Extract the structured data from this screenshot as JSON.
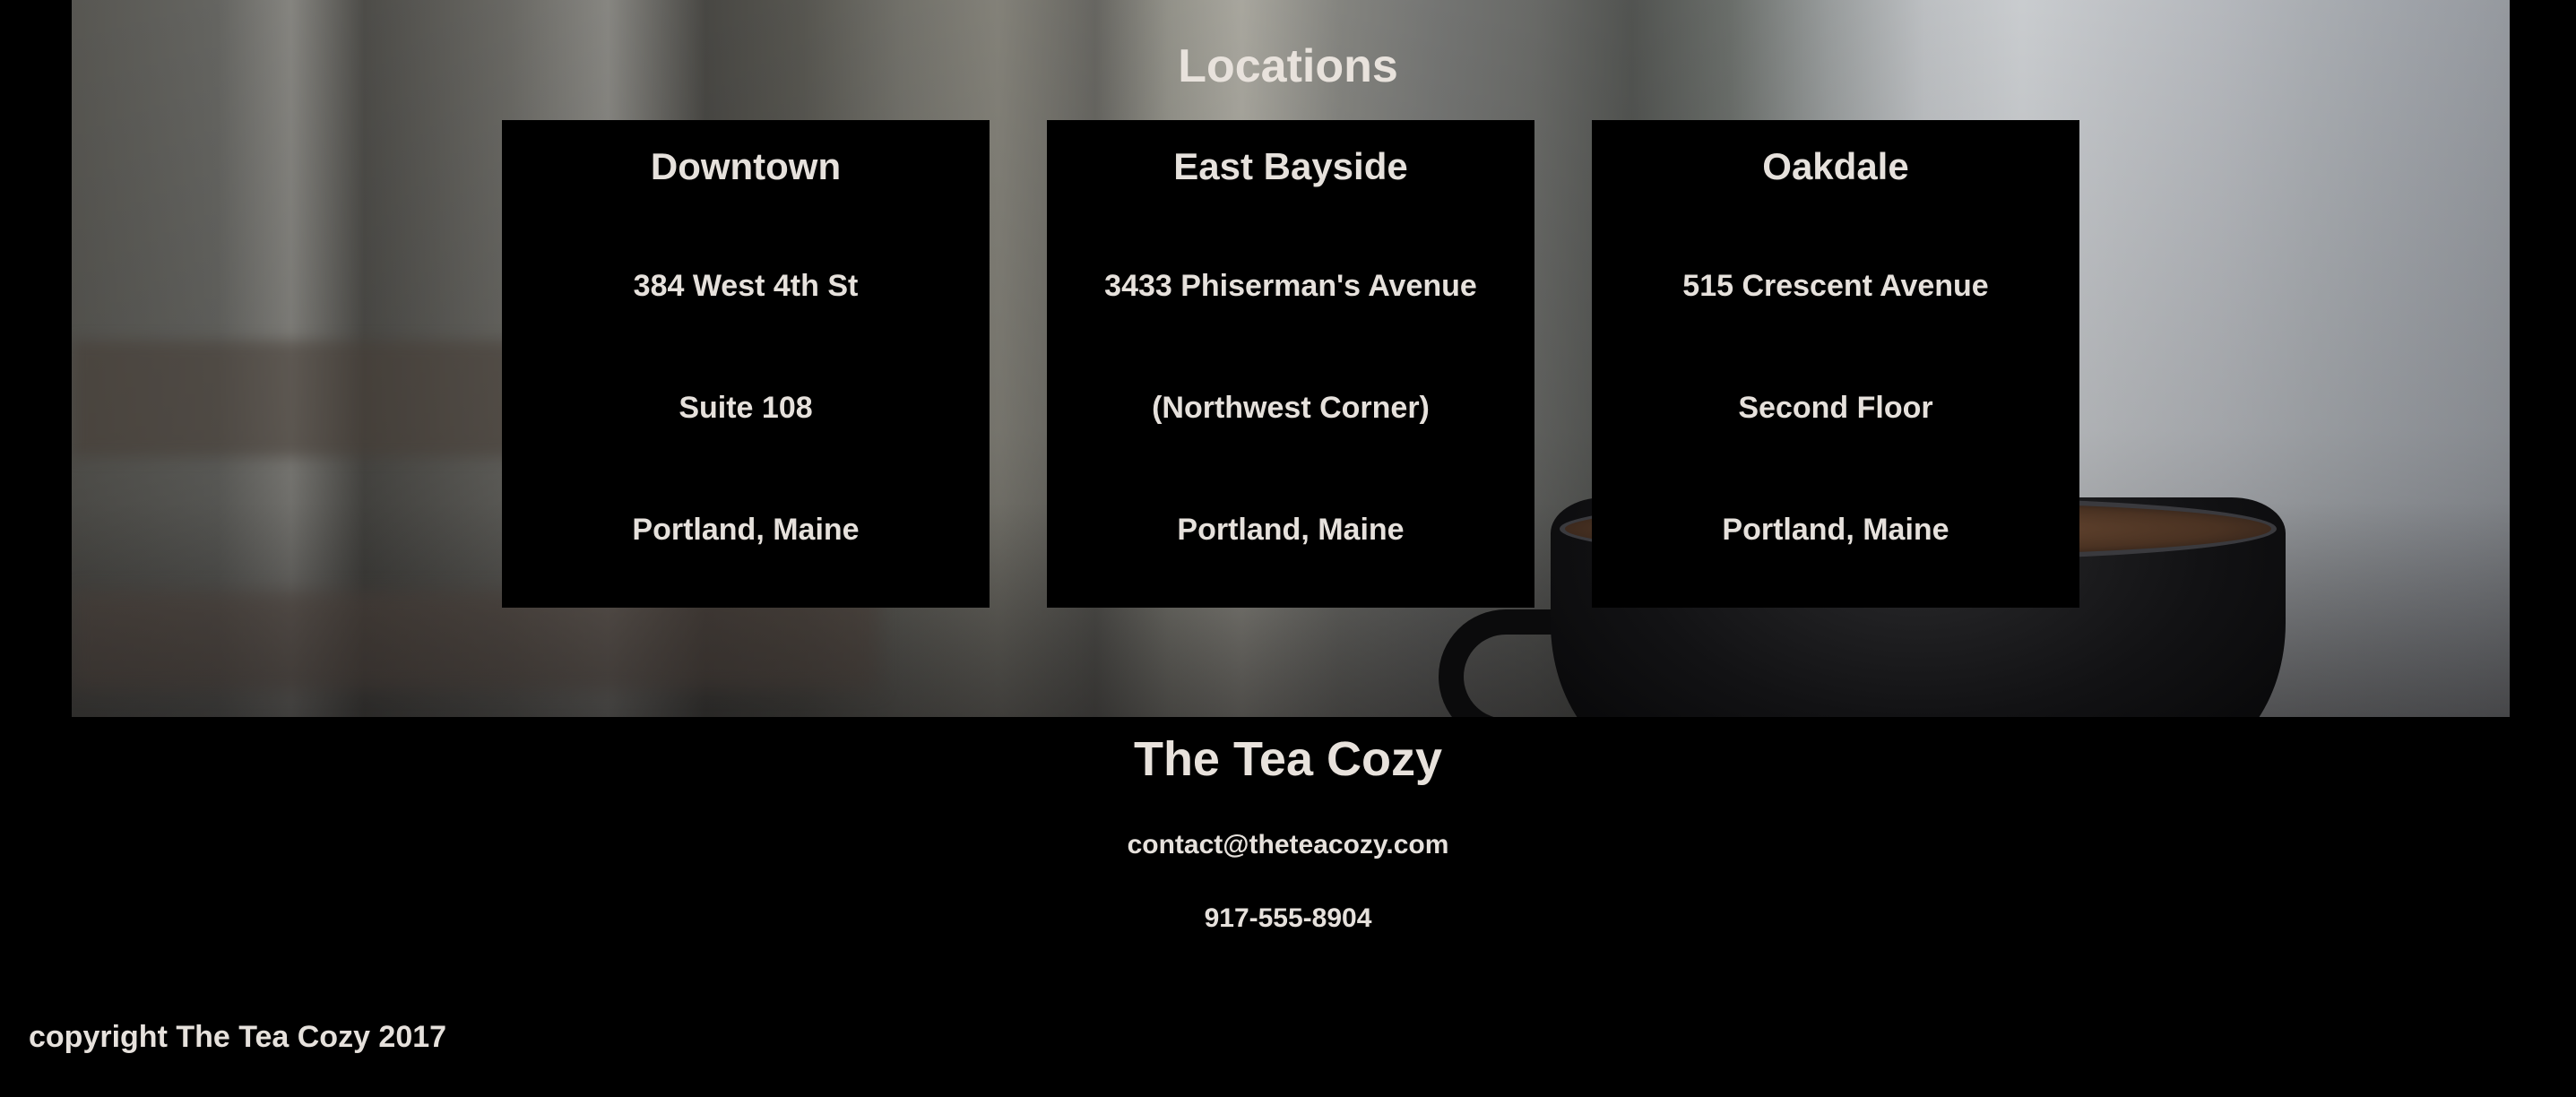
{
  "locations": {
    "title": "Locations",
    "cards": [
      {
        "name": "Downtown",
        "lines": [
          "384 West 4th St",
          "Suite 108",
          "Portland, Maine"
        ]
      },
      {
        "name": "East Bayside",
        "lines": [
          "3433 Phiserman's Avenue",
          "(Northwest Corner)",
          "Portland, Maine"
        ]
      },
      {
        "name": "Oakdale",
        "lines": [
          "515 Crescent Avenue",
          "Second Floor",
          "Portland, Maine"
        ]
      }
    ]
  },
  "footer": {
    "brand": "The Tea Cozy",
    "email": "contact@theteacozy.com",
    "phone": "917-555-8904",
    "copyright": "copyright The Tea Cozy 2017"
  },
  "colors": {
    "background": "#000000",
    "text": "#e6e1dc"
  }
}
